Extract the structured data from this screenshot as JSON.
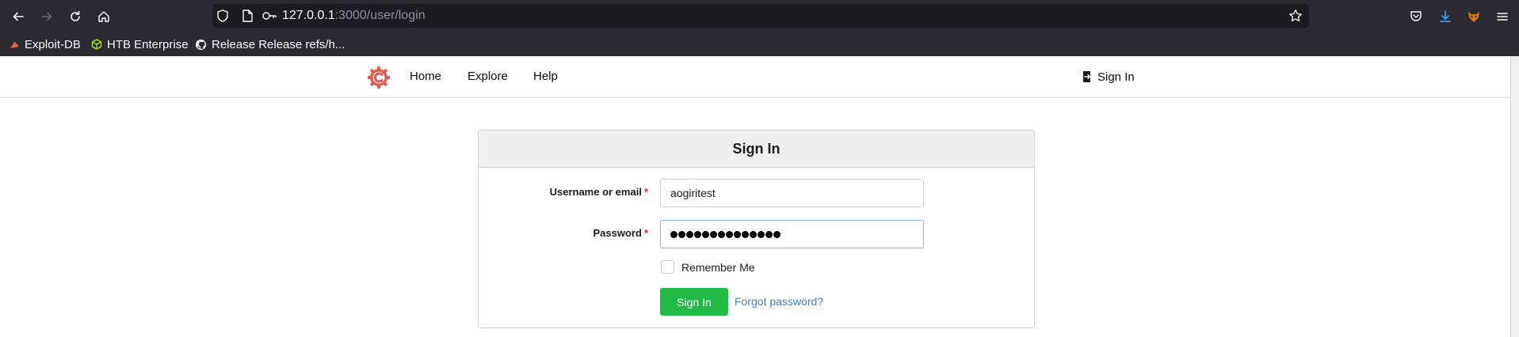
{
  "browser": {
    "url_host": "127.0.0.1",
    "url_path": ":3000/user/login",
    "bookmarks": [
      {
        "label": "Exploit-DB"
      },
      {
        "label": "HTB Enterprise"
      },
      {
        "label": "Release Release refs/h..."
      }
    ]
  },
  "navbar": {
    "items": [
      {
        "label": "Home"
      },
      {
        "label": "Explore"
      },
      {
        "label": "Help"
      }
    ],
    "signin_label": "Sign In"
  },
  "login": {
    "title": "Sign In",
    "username_label": "Username or email",
    "username_value": "aogiritest",
    "password_label": "Password",
    "password_length": 14,
    "required_mark": "*",
    "remember_label": "Remember Me",
    "submit_label": "Sign In",
    "forgot_label": "Forgot password?"
  },
  "colors": {
    "primary_button": "#21ba45",
    "link": "#4183c4",
    "required": "#db2828",
    "chrome_bg": "#2b2a33"
  }
}
